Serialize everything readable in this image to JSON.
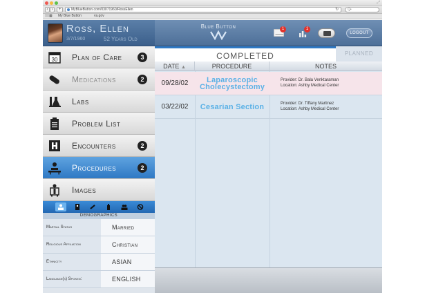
{
  "browser": {
    "url": "MyBlueButton.com/03071960/RossEllen",
    "search_placeholder": "Q•",
    "bookmarks": [
      "My Blue Button",
      "va.gov"
    ],
    "traffic_colors": [
      "#ee5a52",
      "#f4bb40",
      "#5fc14b"
    ]
  },
  "patient": {
    "name": "Ross, Ellen",
    "dob": "3/7/1960",
    "age": "52 Years Old"
  },
  "header": {
    "title": "Blue Button",
    "mail_badge": "1",
    "chart_badge": "1",
    "logout_label": "LOGOUT"
  },
  "nav": {
    "items": [
      {
        "label": "Plan of Care",
        "badge": "3"
      },
      {
        "label": "Medications",
        "badge": "2"
      },
      {
        "label": "Labs",
        "badge": ""
      },
      {
        "label": "Problem List",
        "badge": ""
      },
      {
        "label": "Encounters",
        "badge": "2"
      },
      {
        "label": "Procedures",
        "badge": "2"
      },
      {
        "label": "Images",
        "badge": ""
      }
    ]
  },
  "demographics": {
    "title": "DEMOGRAPHICS",
    "rows": [
      {
        "label": "Martial Status",
        "value": "Married"
      },
      {
        "label": "Religious Affiliation",
        "value": "Christian"
      },
      {
        "label": "Ethnicity",
        "value": "ASIAN"
      },
      {
        "label": "Language(s) Spoken:",
        "value": "ENGLISH"
      }
    ]
  },
  "main": {
    "tab_completed": "COMPLETED",
    "tab_planned": "PLANNED",
    "columns": {
      "date": "DATE",
      "procedure": "PROCEDURE",
      "notes": "NOTES"
    },
    "rows": [
      {
        "date": "09/28/02",
        "procedure": "Laparoscopic Cholecystectomy",
        "provider": "Provider: Dr. Bala Venktaraman",
        "location": "Location: Ashby Medical Center"
      },
      {
        "date": "03/22/02",
        "procedure": "Cesarian Section",
        "provider": "Provider: Dr. Tiffany Martinez",
        "location": "Location: Ashby Medical Center"
      }
    ]
  },
  "colors": {
    "accent": "#2f79c4",
    "procedure_text": "#5bb1e6",
    "badge_red": "#e2322b"
  }
}
